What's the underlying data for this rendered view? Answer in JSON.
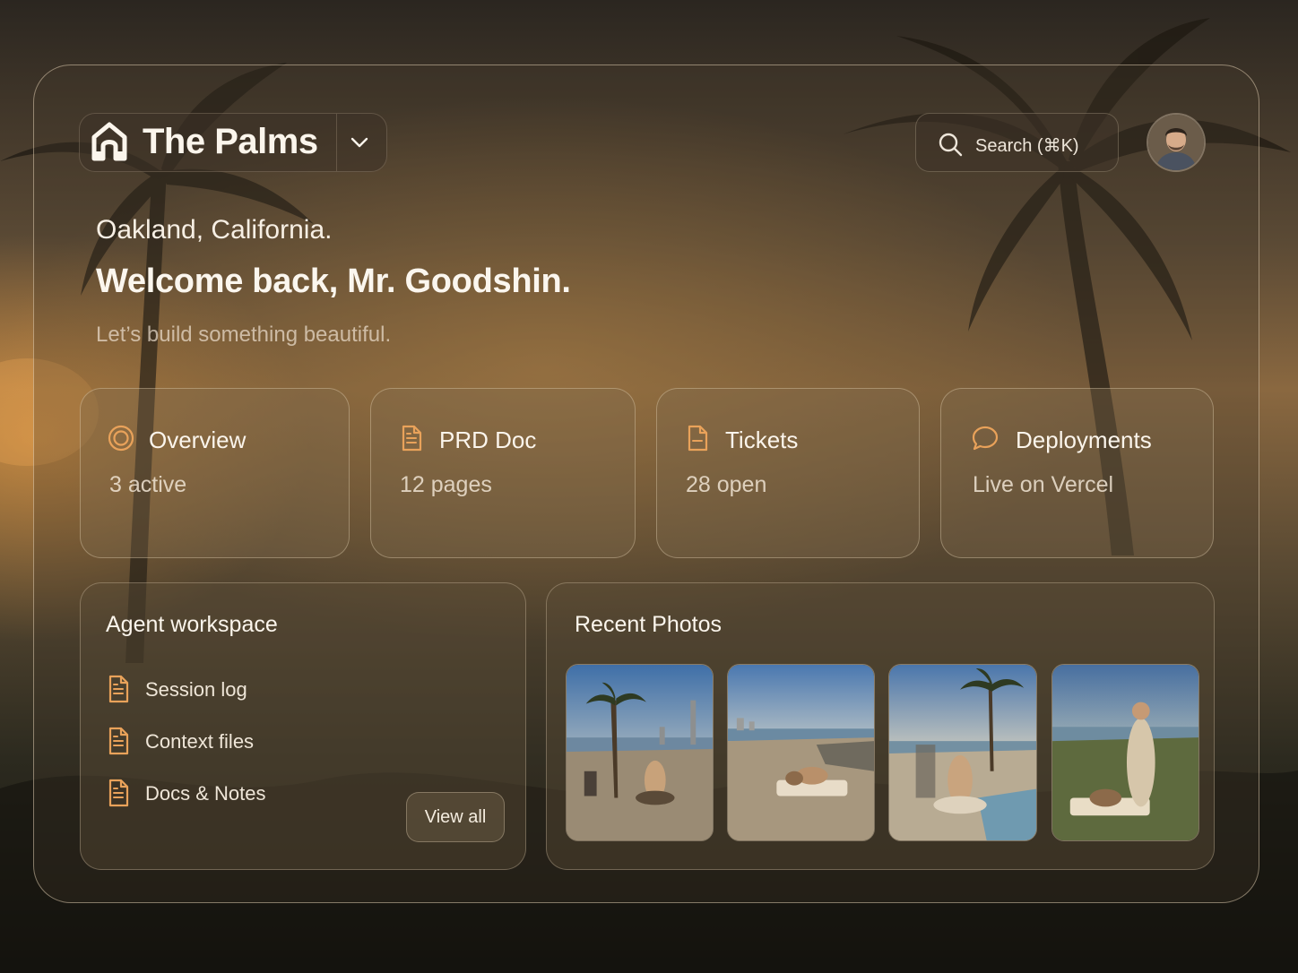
{
  "header": {
    "brand_name": "The Palms",
    "search_label": "Search (⌘K)"
  },
  "hero": {
    "location": "Oakland, California.",
    "welcome": "Welcome back, Mr. Goodshin.",
    "tagline": "Let’s build something beautiful."
  },
  "cards": [
    {
      "title": "Overview",
      "subtitle": "3 active",
      "icon": "target-icon"
    },
    {
      "title": "PRD Doc",
      "subtitle": "12 pages",
      "icon": "document-icon"
    },
    {
      "title": "Tickets",
      "subtitle": "28 open",
      "icon": "ticket-icon"
    },
    {
      "title": "Deployments",
      "subtitle": "Live on Vercel",
      "icon": "chat-bubble-icon"
    }
  ],
  "workspace": {
    "title": "Agent workspace",
    "items": [
      {
        "label": "Session log",
        "icon": "document-icon"
      },
      {
        "label": "Context files",
        "icon": "document-icon"
      },
      {
        "label": "Docs & Notes",
        "icon": "document-icon"
      }
    ],
    "view_all_label": "View all"
  },
  "photos": {
    "title": "Recent Photos",
    "count_shown": 4
  },
  "colors": {
    "accent": "#e9a25a",
    "panel_border": "#ffebcd",
    "text_primary": "#fbf5ec"
  }
}
